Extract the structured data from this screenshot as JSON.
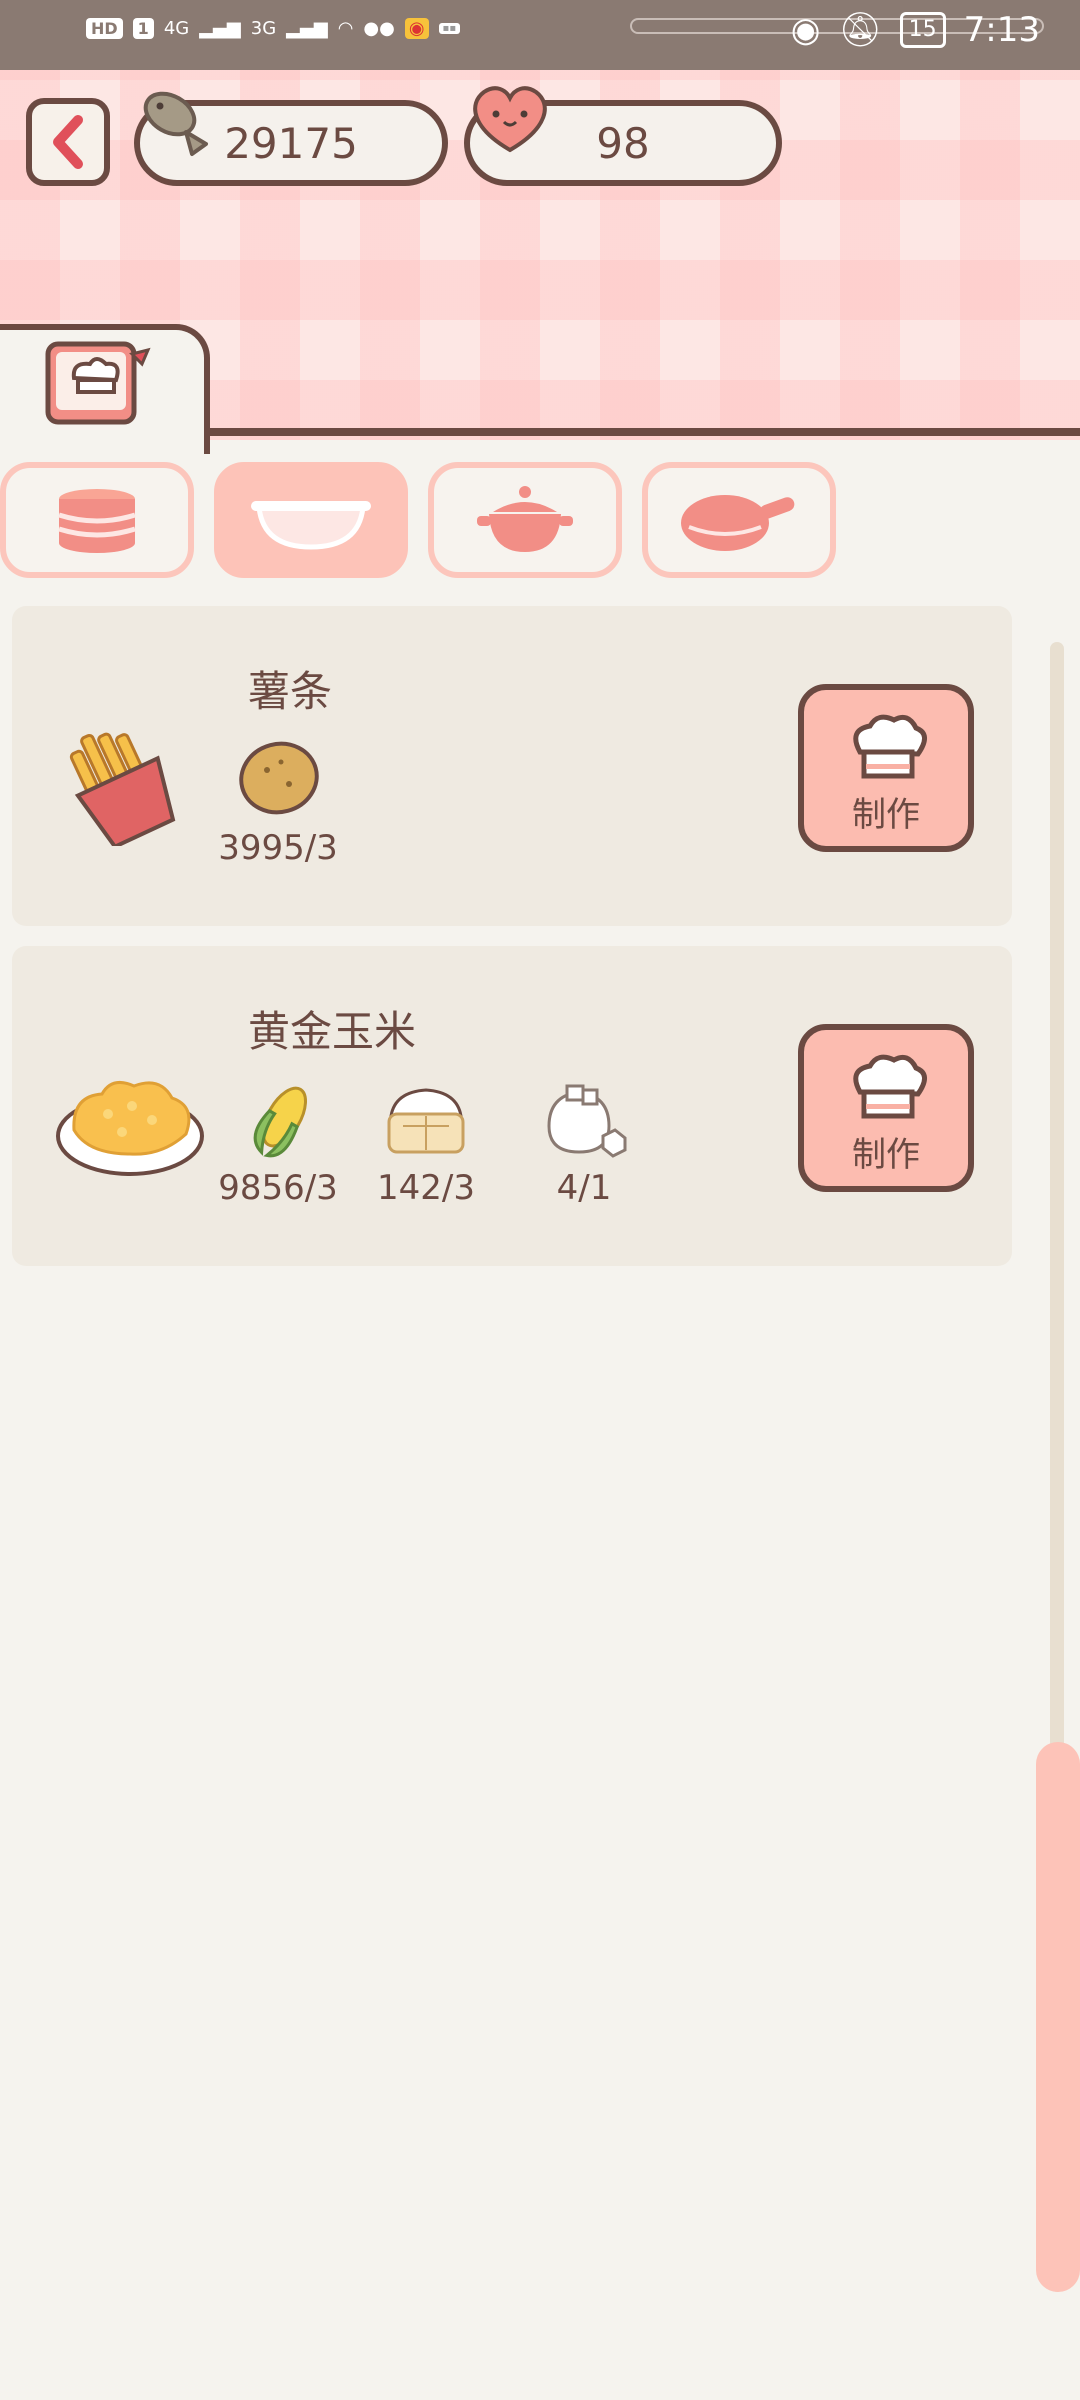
{
  "status_bar": {
    "time": "7:13",
    "battery": "15",
    "left_chips": [
      "HD",
      "1",
      "4G",
      "3G"
    ]
  },
  "currency": {
    "fish_count": "29175",
    "heart_count": "98"
  },
  "categories": [
    {
      "name": "drum",
      "active": false
    },
    {
      "name": "bowl",
      "active": true
    },
    {
      "name": "pot",
      "active": false
    },
    {
      "name": "pan",
      "active": false
    }
  ],
  "recipes": [
    {
      "name": "薯条",
      "ingredients": [
        {
          "icon": "potato-icon",
          "count": "3995/3"
        }
      ],
      "make_label": "制作"
    },
    {
      "name": "黄金玉米",
      "ingredients": [
        {
          "icon": "corn-icon",
          "count": "9856/3"
        },
        {
          "icon": "flour-icon",
          "count": "142/3"
        },
        {
          "icon": "sugar-icon",
          "count": "4/1"
        }
      ],
      "make_label": "制作"
    }
  ],
  "colors": {
    "outline": "#6b4a42",
    "accent": "#fdc3b8",
    "card": "#efeae1",
    "background": "#f5f3ee"
  }
}
